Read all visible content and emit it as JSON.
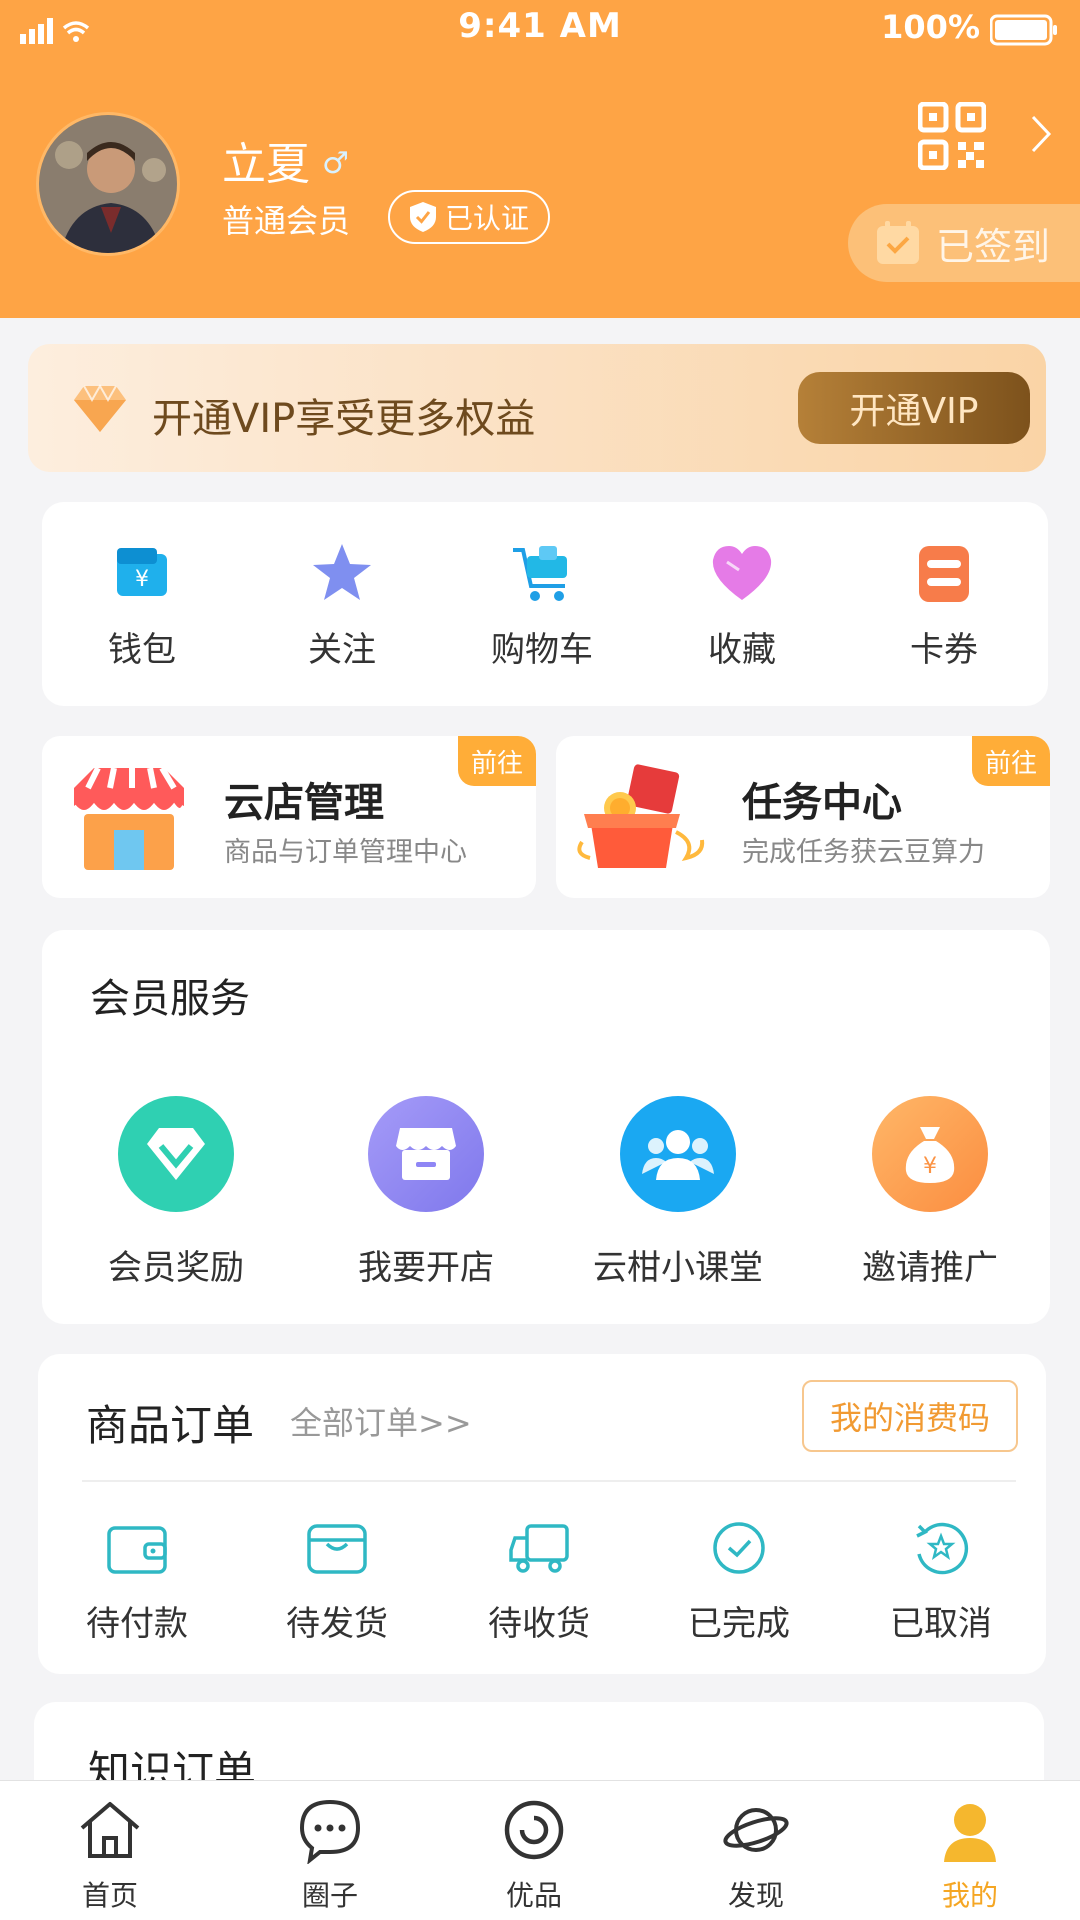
{
  "status_bar": {
    "time": "9:41 AM",
    "battery": "100%"
  },
  "profile": {
    "name": "立夏",
    "gender_symbol": "♂",
    "level": "普通会员",
    "verified_label": "已认证",
    "signin_label": "已签到"
  },
  "vip_banner": {
    "text": "开通VIP享受更多权益",
    "button": "开通VIP"
  },
  "quick_actions": [
    {
      "label": "钱包",
      "icon": "wallet-icon"
    },
    {
      "label": "关注",
      "icon": "star-icon"
    },
    {
      "label": "购物车",
      "icon": "cart-icon"
    },
    {
      "label": "收藏",
      "icon": "heart-icon"
    },
    {
      "label": "卡券",
      "icon": "coupon-icon"
    }
  ],
  "features": [
    {
      "tag": "前往",
      "title": "云店管理",
      "subtitle": "商品与订单管理中心",
      "icon": "store-icon"
    },
    {
      "tag": "前往",
      "title": "任务中心",
      "subtitle": "完成任务获云豆算力",
      "icon": "gift-box-icon"
    }
  ],
  "member_services": {
    "title": "会员服务",
    "items": [
      {
        "label": "会员奖励",
        "icon": "diamond-icon",
        "color": "#2fd0b2"
      },
      {
        "label": "我要开店",
        "icon": "shop-icon",
        "color": "#8f86f5"
      },
      {
        "label": "云柑小课堂",
        "icon": "people-icon",
        "color": "#1aa8f2"
      },
      {
        "label": "邀请推广",
        "icon": "money-bag-icon",
        "color": "#fd9c4c"
      }
    ]
  },
  "orders": {
    "title": "商品订单",
    "all_link": "全部订单>>",
    "code_button": "我的消费码",
    "statuses": [
      {
        "label": "待付款",
        "icon": "wallet-outline-icon"
      },
      {
        "label": "待发货",
        "icon": "package-icon"
      },
      {
        "label": "待收货",
        "icon": "truck-icon"
      },
      {
        "label": "已完成",
        "icon": "check-circle-icon"
      },
      {
        "label": "已取消",
        "icon": "cancel-star-icon"
      }
    ]
  },
  "knowledge_orders": {
    "title": "知识订单"
  },
  "tabbar": [
    {
      "label": "首页",
      "icon": "home-icon"
    },
    {
      "label": "圈子",
      "icon": "chat-icon"
    },
    {
      "label": "优品",
      "icon": "circle-icon"
    },
    {
      "label": "发现",
      "icon": "planet-icon"
    },
    {
      "label": "我的",
      "icon": "profile-icon",
      "active": true
    }
  ],
  "colors": {
    "header": "#fea445",
    "accent": "#f5a623",
    "teal": "#2fb8c4"
  }
}
